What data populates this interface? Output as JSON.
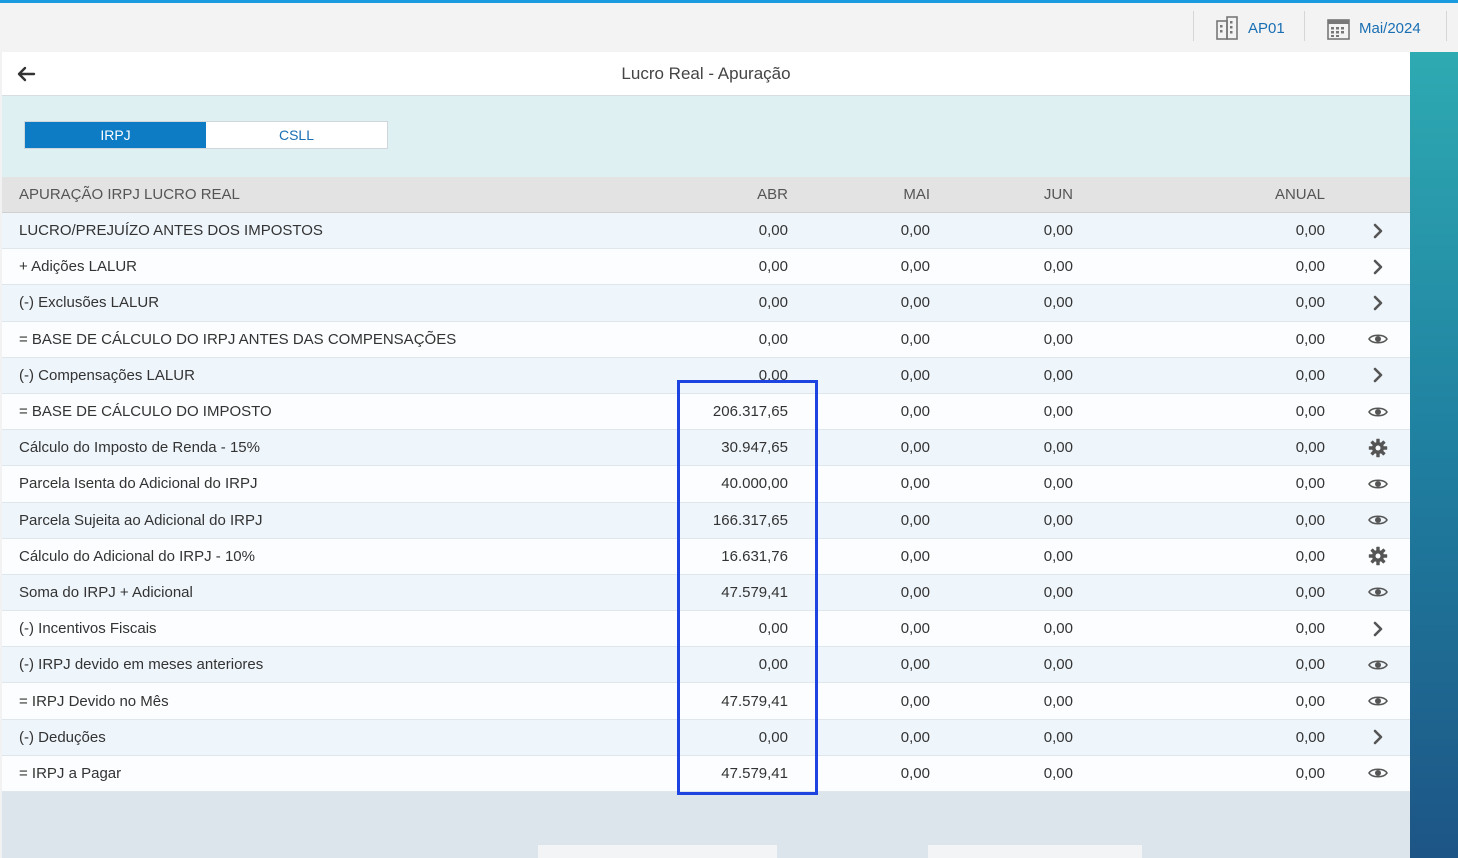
{
  "topbar": {
    "company": "AP01",
    "period": "Mai/2024",
    "company_icon": "building-icon",
    "period_icon": "calendar-icon"
  },
  "header": {
    "title": "Lucro Real - Apuração",
    "back_icon": "arrow-left-icon"
  },
  "tabs": [
    {
      "label": "IRPJ",
      "active": true
    },
    {
      "label": "CSLL",
      "active": false
    }
  ],
  "table": {
    "columns": {
      "label": "APURAÇÃO IRPJ LUCRO REAL",
      "abr": "ABR",
      "mai": "MAI",
      "jun": "JUN",
      "anual": "ANUAL"
    },
    "rows": [
      {
        "label": "LUCRO/PREJUÍZO ANTES DOS IMPOSTOS",
        "abr": "0,00",
        "mai": "0,00",
        "jun": "0,00",
        "anual": "0,00",
        "icon": "chevron-right-icon"
      },
      {
        "label": "+ Adições LALUR",
        "abr": "0,00",
        "mai": "0,00",
        "jun": "0,00",
        "anual": "0,00",
        "icon": "chevron-right-icon"
      },
      {
        "label": "(-) Exclusões LALUR",
        "abr": "0,00",
        "mai": "0,00",
        "jun": "0,00",
        "anual": "0,00",
        "icon": "chevron-right-icon"
      },
      {
        "label": "= BASE DE CÁLCULO DO IRPJ ANTES DAS COMPENSAÇÕES",
        "abr": "0,00",
        "mai": "0,00",
        "jun": "0,00",
        "anual": "0,00",
        "icon": "eye-icon"
      },
      {
        "label": "(-) Compensações LALUR",
        "abr": "0,00",
        "mai": "0,00",
        "jun": "0,00",
        "anual": "0,00",
        "icon": "chevron-right-icon"
      },
      {
        "label": "= BASE DE CÁLCULO DO IMPOSTO",
        "abr": "206.317,65",
        "mai": "0,00",
        "jun": "0,00",
        "anual": "0,00",
        "icon": "eye-icon"
      },
      {
        "label": "Cálculo do Imposto de Renda - 15%",
        "abr": "30.947,65",
        "mai": "0,00",
        "jun": "0,00",
        "anual": "0,00",
        "icon": "gear-icon"
      },
      {
        "label": "Parcela Isenta do Adicional do IRPJ",
        "abr": "40.000,00",
        "mai": "0,00",
        "jun": "0,00",
        "anual": "0,00",
        "icon": "eye-icon"
      },
      {
        "label": "Parcela Sujeita ao Adicional do IRPJ",
        "abr": "166.317,65",
        "mai": "0,00",
        "jun": "0,00",
        "anual": "0,00",
        "icon": "eye-icon"
      },
      {
        "label": "Cálculo do Adicional do IRPJ - 10%",
        "abr": "16.631,76",
        "mai": "0,00",
        "jun": "0,00",
        "anual": "0,00",
        "icon": "gear-icon"
      },
      {
        "label": "Soma do IRPJ + Adicional",
        "abr": "47.579,41",
        "mai": "0,00",
        "jun": "0,00",
        "anual": "0,00",
        "icon": "eye-icon"
      },
      {
        "label": "(-) Incentivos Fiscais",
        "abr": "0,00",
        "mai": "0,00",
        "jun": "0,00",
        "anual": "0,00",
        "icon": "chevron-right-icon"
      },
      {
        "label": "(-) IRPJ devido em meses anteriores",
        "abr": "0,00",
        "mai": "0,00",
        "jun": "0,00",
        "anual": "0,00",
        "icon": "eye-icon"
      },
      {
        "label": "= IRPJ Devido no Mês",
        "abr": "47.579,41",
        "mai": "0,00",
        "jun": "0,00",
        "anual": "0,00",
        "icon": "eye-icon"
      },
      {
        "label": "(-) Deduções",
        "abr": "0,00",
        "mai": "0,00",
        "jun": "0,00",
        "anual": "0,00",
        "icon": "chevron-right-icon"
      },
      {
        "label": "= IRPJ a Pagar",
        "abr": "47.579,41",
        "mai": "0,00",
        "jun": "0,00",
        "anual": "0,00",
        "icon": "eye-icon"
      }
    ]
  },
  "colors": {
    "accent": "#0e7cc5",
    "highlight": "#1d43e0",
    "link": "#1a6fb3"
  }
}
